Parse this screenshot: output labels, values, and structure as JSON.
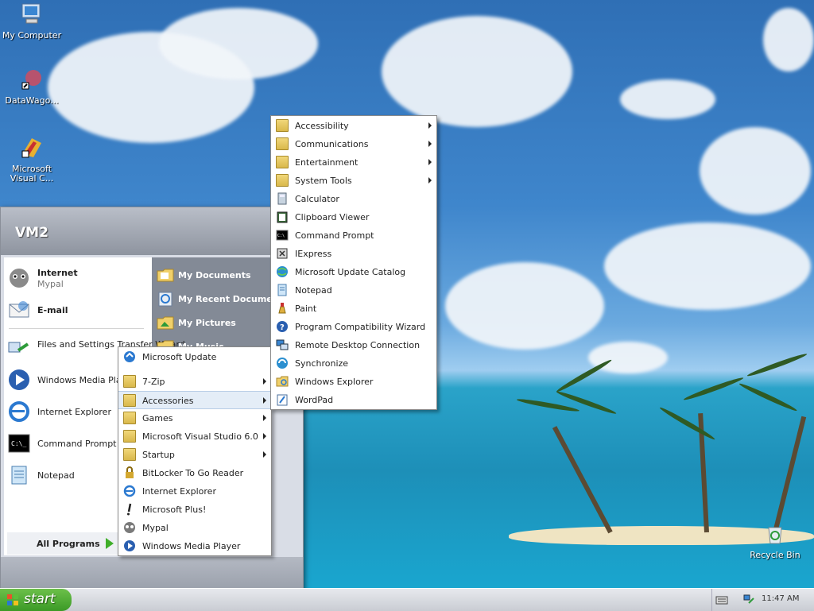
{
  "desktop": {
    "icons": [
      {
        "label": "My Computer",
        "icon": "computer-icon"
      },
      {
        "label": "DataWago...",
        "icon": "shortcut-icon"
      },
      {
        "label": "Microsoft Visual C...",
        "icon": "visual-studio-icon"
      },
      {
        "label": "Recycle Bin",
        "icon": "recycle-bin-icon"
      }
    ]
  },
  "start_menu": {
    "user": "VM2",
    "pinned": [
      {
        "title": "Internet",
        "subtitle": "Mypal",
        "icon": "mypal-icon"
      },
      {
        "title": "E-mail",
        "icon": "email-icon"
      }
    ],
    "recent": [
      {
        "title": "Files and Settings Transfer Wizard",
        "icon": "transfer-wizard-icon"
      },
      {
        "title": "Windows Media Pla",
        "icon": "media-player-icon"
      },
      {
        "title": "Internet Explorer",
        "icon": "ie-icon"
      },
      {
        "title": "Command Prompt",
        "icon": "cmd-icon"
      },
      {
        "title": "Notepad",
        "icon": "notepad-icon"
      }
    ],
    "right_links": [
      {
        "title": "My Documents",
        "icon": "folder-docs-icon"
      },
      {
        "title": "My Recent Documents",
        "icon": "recent-docs-icon"
      },
      {
        "title": "My Pictures",
        "icon": "folder-pictures-icon"
      },
      {
        "title": "My Music",
        "icon": "folder-music-icon"
      }
    ],
    "all_programs_label": "All Programs"
  },
  "programs_menu": {
    "items": [
      {
        "label": "Microsoft Update",
        "icon": "windows-update-icon",
        "submenu": false
      },
      {
        "label": "7-Zip",
        "icon": "folder-icon",
        "submenu": true
      },
      {
        "label": "Accessories",
        "icon": "folder-icon",
        "submenu": true,
        "selected": true
      },
      {
        "label": "Games",
        "icon": "folder-icon",
        "submenu": true
      },
      {
        "label": "Microsoft Visual Studio 6.0",
        "icon": "folder-icon",
        "submenu": true
      },
      {
        "label": "Startup",
        "icon": "folder-icon",
        "submenu": true
      },
      {
        "label": "BitLocker To Go Reader",
        "icon": "bitlocker-icon",
        "submenu": false
      },
      {
        "label": "Internet Explorer",
        "icon": "ie-icon",
        "submenu": false
      },
      {
        "label": "Microsoft Plus!",
        "icon": "plus-icon",
        "submenu": false
      },
      {
        "label": "Mypal",
        "icon": "mypal-icon",
        "submenu": false
      },
      {
        "label": "Windows Media Player",
        "icon": "media-player-icon",
        "submenu": false
      }
    ]
  },
  "accessories_menu": {
    "items": [
      {
        "label": "Accessibility",
        "icon": "folder-icon",
        "submenu": true
      },
      {
        "label": "Communications",
        "icon": "folder-icon",
        "submenu": true
      },
      {
        "label": "Entertainment",
        "icon": "folder-icon",
        "submenu": true
      },
      {
        "label": "System Tools",
        "icon": "folder-icon",
        "submenu": true
      },
      {
        "label": "Calculator",
        "icon": "calculator-icon",
        "submenu": false
      },
      {
        "label": "Clipboard Viewer",
        "icon": "clipboard-icon",
        "submenu": false
      },
      {
        "label": "Command Prompt",
        "icon": "cmd-icon",
        "submenu": false
      },
      {
        "label": "IExpress",
        "icon": "iexpress-icon",
        "submenu": false
      },
      {
        "label": "Microsoft Update Catalog",
        "icon": "globe-icon",
        "submenu": false
      },
      {
        "label": "Notepad",
        "icon": "notepad-icon",
        "submenu": false
      },
      {
        "label": "Paint",
        "icon": "paint-icon",
        "submenu": false
      },
      {
        "label": "Program Compatibility Wizard",
        "icon": "help-icon",
        "submenu": false
      },
      {
        "label": "Remote Desktop Connection",
        "icon": "remote-desktop-icon",
        "submenu": false
      },
      {
        "label": "Synchronize",
        "icon": "sync-icon",
        "submenu": false
      },
      {
        "label": "Windows Explorer",
        "icon": "explorer-icon",
        "submenu": false
      },
      {
        "label": "WordPad",
        "icon": "wordpad-icon",
        "submenu": false
      }
    ]
  },
  "taskbar": {
    "start_label": "start",
    "clock": "11:47 AM"
  },
  "colors": {
    "start_green": "#3b9a26",
    "menu_selected": "#e4edf7",
    "right_pane": "#838a96"
  }
}
